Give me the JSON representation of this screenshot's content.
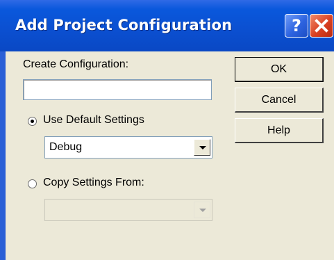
{
  "window": {
    "title": "Add Project Configuration",
    "help_glyph": "?",
    "icons": [
      "help-icon",
      "close-icon"
    ]
  },
  "form": {
    "create_label": "Create Configuration:",
    "create_value": "",
    "use_default_label": "Use Default Settings",
    "use_default_checked": true,
    "default_select_value": "Debug",
    "copy_from_label": "Copy Settings From:",
    "copy_from_checked": false,
    "copy_select_value": ""
  },
  "buttons": {
    "ok": "OK",
    "cancel": "Cancel",
    "help": "Help"
  },
  "colors": {
    "titlebar": "#0a58dc",
    "dialog_bg": "#ece9d8",
    "close": "#d94022"
  }
}
